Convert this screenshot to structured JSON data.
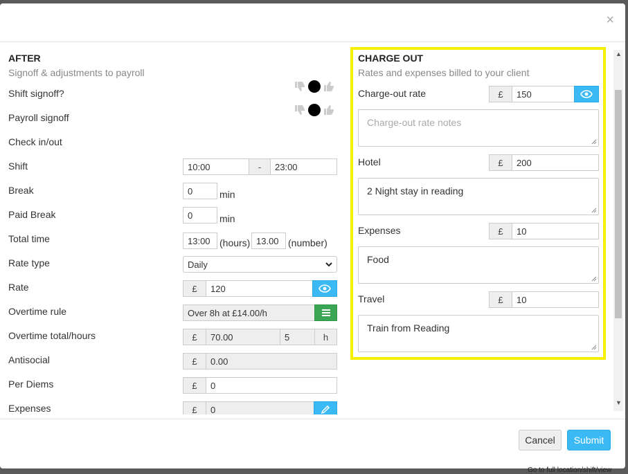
{
  "close_label": "×",
  "after": {
    "title": "AFTER",
    "subtitle": "Signoff & adjustments to payroll",
    "shift_signoff_label": "Shift signoff?",
    "payroll_signoff_label": "Payroll signoff",
    "check_in_out_label": "Check in/out",
    "shift_label": "Shift",
    "shift_start": "10:00",
    "shift_sep": "-",
    "shift_end": "23:00",
    "break_label": "Break",
    "break_value": "0",
    "break_unit": "min",
    "paid_break_label": "Paid Break",
    "paid_break_value": "0",
    "paid_break_unit": "min",
    "total_time_label": "Total time",
    "total_hours_value": "13:00",
    "total_hours_unit": "(hours)",
    "total_number_value": "13.00",
    "total_number_unit": "(number)",
    "rate_type_label": "Rate type",
    "rate_type_value": "Daily",
    "rate_label": "Rate",
    "rate_currency": "£",
    "rate_value": "120",
    "overtime_rule_label": "Overtime rule",
    "overtime_rule_value": "Over 8h at £14.00/h",
    "overtime_total_label": "Overtime total/hours",
    "overtime_currency": "£",
    "overtime_total_value": "70.00",
    "overtime_hours_value": "5",
    "overtime_hours_unit": "h",
    "antisocial_label": "Antisocial",
    "antisocial_currency": "£",
    "antisocial_value": "0.00",
    "per_diems_label": "Per Diems",
    "per_diems_currency": "£",
    "per_diems_value": "0",
    "expenses_label": "Expenses",
    "expenses_currency": "£",
    "expenses_value": "0"
  },
  "charge_out": {
    "title": "CHARGE OUT",
    "subtitle": "Rates and expenses billed to your client",
    "rate_label": "Charge-out rate",
    "rate_currency": "£",
    "rate_value": "150",
    "rate_notes_placeholder": "Charge-out rate notes",
    "hotel_label": "Hotel",
    "hotel_currency": "£",
    "hotel_value": "200",
    "hotel_notes": "2 Night stay in reading",
    "expenses_label": "Expenses",
    "expenses_currency": "£",
    "expenses_value": "10",
    "expenses_notes": "Food",
    "travel_label": "Travel",
    "travel_currency": "£",
    "travel_value": "10",
    "travel_notes": "Train from Reading"
  },
  "footer": {
    "cancel_label": "Cancel",
    "submit_label": "Submit"
  },
  "background_link": "Go to full location/shift/view",
  "colors": {
    "accent": "#3bb9f5",
    "green": "#3aa655",
    "highlight": "#f5ef00"
  }
}
